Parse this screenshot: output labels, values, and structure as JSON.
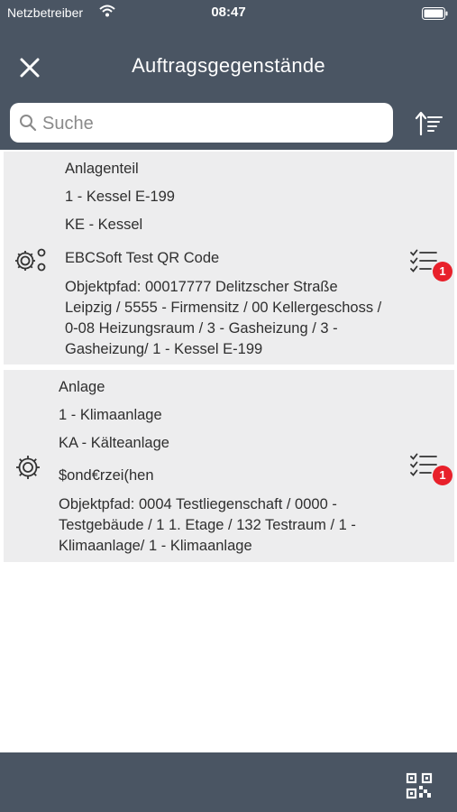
{
  "status_bar": {
    "carrier": "Netzbetreiber",
    "time": "08:47"
  },
  "header": {
    "title": "Auftragsgegenstände"
  },
  "search": {
    "placeholder": "Suche",
    "value": ""
  },
  "items": [
    {
      "type": "Anlagenteil",
      "number": "1 - Kessel E-199",
      "category": "KE - Kessel",
      "code": "EBCSoft Test QR Code",
      "path_lines": [
        "Objektpfad: 00017777 Delitzscher Straße",
        "Leipzig / 5555 - Firmensitz / 00 Kellergeschoss /",
        "0-08 Heizungsraum / 3 - Gasheizung / 3 -",
        "Gasheizung/ 1 - Kessel E-199"
      ],
      "icon": "gears-icon",
      "checklist_count": "1"
    },
    {
      "type": "Anlage",
      "number": "1 - Klimaanlage",
      "category": "KA - Kälteanlage",
      "code": "$ond€rzei(hen",
      "path_lines": [
        "Objektpfad: 0004 Testliegenschaft / 0000 -",
        "Testgebäude / 1 1. Etage / 132 Testraum / 1 -",
        "Klimaanlage/ 1 - Klimaanlage"
      ],
      "icon": "gear-icon",
      "checklist_count": "1"
    }
  ],
  "colors": {
    "header_bg": "#4a5563",
    "item_bg": "#ededee",
    "badge": "#e8202a"
  }
}
